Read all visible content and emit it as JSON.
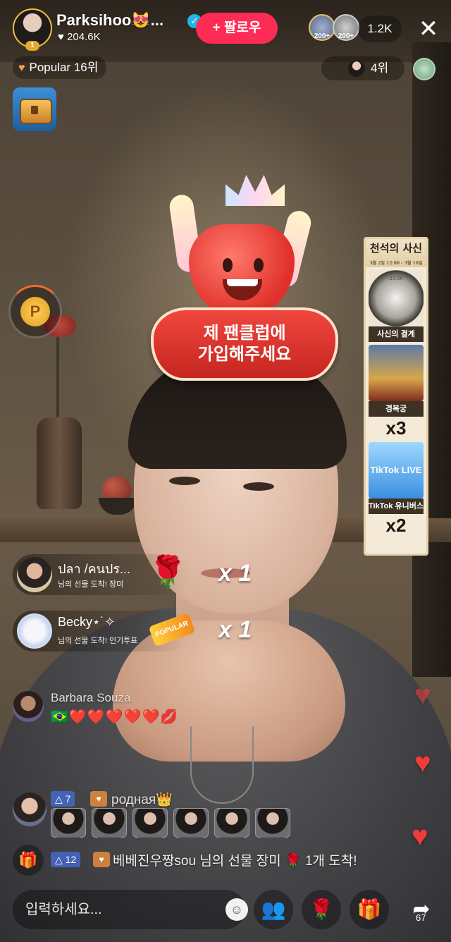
{
  "host": {
    "name": "Parksihoo😻...",
    "likes": "♥ 204.6K",
    "rank_level": "1",
    "follow_label": "+ 팔로우"
  },
  "viewers": {
    "avatar_badges": [
      "200+",
      "200+"
    ],
    "count": "1.2K",
    "close_symbol": "✕"
  },
  "popular": {
    "label": "Popular 16위"
  },
  "ranking": {
    "label": "4위"
  },
  "coin": {
    "symbol": "P"
  },
  "sticker": {
    "text": "제 팬클럽에\n가입해주세요"
  },
  "gift_panel": {
    "title": "천석의 사신",
    "subtitle": "3월 2일 12:00 - 3월 16일 23:59",
    "items": [
      {
        "label": "사신의 결계",
        "count": ""
      },
      {
        "label": "경복궁",
        "count": "x3"
      },
      {
        "label": "TikTok 유니버스",
        "count": "x2",
        "logo": "TikTok LIVE"
      }
    ]
  },
  "gift_combos": [
    {
      "name": "ปลา /คนปร...",
      "sub": "님의 선물 도착! 장미",
      "gift_icon": "rose-icon",
      "gift_glyph": "🌹",
      "multiplier": "x 1"
    },
    {
      "name": "Becky⋆˙✧",
      "sub": "님의 선물 도착! 인기투표",
      "gift_icon": "popular-badge-icon",
      "gift_glyph": "POPULAR",
      "multiplier": "x 1"
    }
  ],
  "comments": [
    {
      "name": "Barbara Souza",
      "text": "🇧🇷❤️❤️❤️❤️❤️💋"
    },
    {
      "name": "родная👑",
      "level": "△ 7"
    }
  ],
  "system_message": {
    "level": "△ 12",
    "text": "베베진우짱sou 님의 선물 장미 🌹 1개 도착!"
  },
  "bottom_bar": {
    "input_placeholder": "입력하세요...",
    "share_count": "67"
  },
  "colors": {
    "follow_button": "#fe2c55",
    "verified": "#20b7e8",
    "heart": "#f03b3b"
  }
}
